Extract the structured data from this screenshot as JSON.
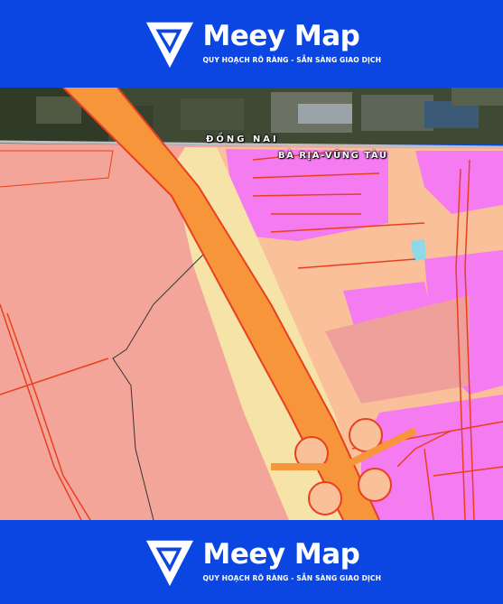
{
  "brand": {
    "name": "Meey Map",
    "tagline": "QUY HOẠCH RÕ RÀNG - SẴN SÀNG GIAO DỊCH",
    "logo_icon": "meey-logo-icon"
  },
  "map": {
    "labels": {
      "province_north": "ĐỒNG NAI",
      "province_south": "BÀ RỊA-VŨNG TÀU"
    },
    "legend_colors": {
      "agricultural_land": "#f4a59a",
      "residential_land": "#f9c09a",
      "urban_mixed": "#f57cf0",
      "green_buffer": "#f6e3a8",
      "highway": "#f7953b",
      "road": "#e8401f",
      "water": "#8fd8e8",
      "background_band": "#0b46e2"
    }
  }
}
